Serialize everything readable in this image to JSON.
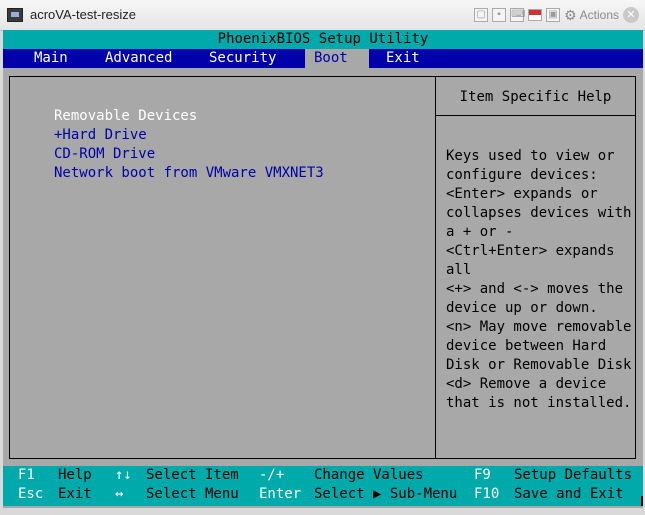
{
  "window": {
    "title": "acroVA-test-resize",
    "actions_label": "Actions",
    "close_glyph": "✕"
  },
  "bios": {
    "title": "PhoenixBIOS Setup Utility",
    "menu": [
      {
        "label": "Main"
      },
      {
        "label": "Advanced"
      },
      {
        "label": "Security"
      },
      {
        "label": "Boot",
        "active": true
      },
      {
        "label": "Exit"
      }
    ],
    "boot_items": [
      "Removable Devices",
      "+Hard Drive",
      "CD-ROM Drive",
      "Network boot from VMware VMXNET3"
    ],
    "selected_boot_item": "Removable Devices",
    "help_title": "Item Specific Help",
    "help_text": "Keys used to view or\nconfigure devices:\n<Enter> expands or\ncollapses devices with\na + or -\n<Ctrl+Enter> expands\nall\n<+> and <-> moves the\ndevice up or down.\n<n> May move removable\ndevice between Hard\nDisk or Removable Disk\n<d> Remove a device\nthat is not installed.",
    "footer": {
      "f1_key": "F1",
      "f1_label": "Help",
      "esc_key": "Esc",
      "esc_label": "Exit",
      "updown_key": "↑↓",
      "updown_label": "Select Item",
      "leftright_key": "↔",
      "leftright_label": "Select Menu",
      "plusminus_key": "-/+",
      "plusminus_label": "Change Values",
      "enter_key": "Enter",
      "enter_label": "Select ▶ Sub-Menu",
      "f9_key": "F9",
      "f9_label": "Setup Defaults",
      "f10_key": "F10",
      "f10_label": "Save and Exit"
    },
    "colors": {
      "background": "#a8a8a8",
      "title_bar": "#00aaaa",
      "menu_bar": "#0000aa",
      "text": "#0000aa",
      "highlight": "#ffffff"
    }
  }
}
